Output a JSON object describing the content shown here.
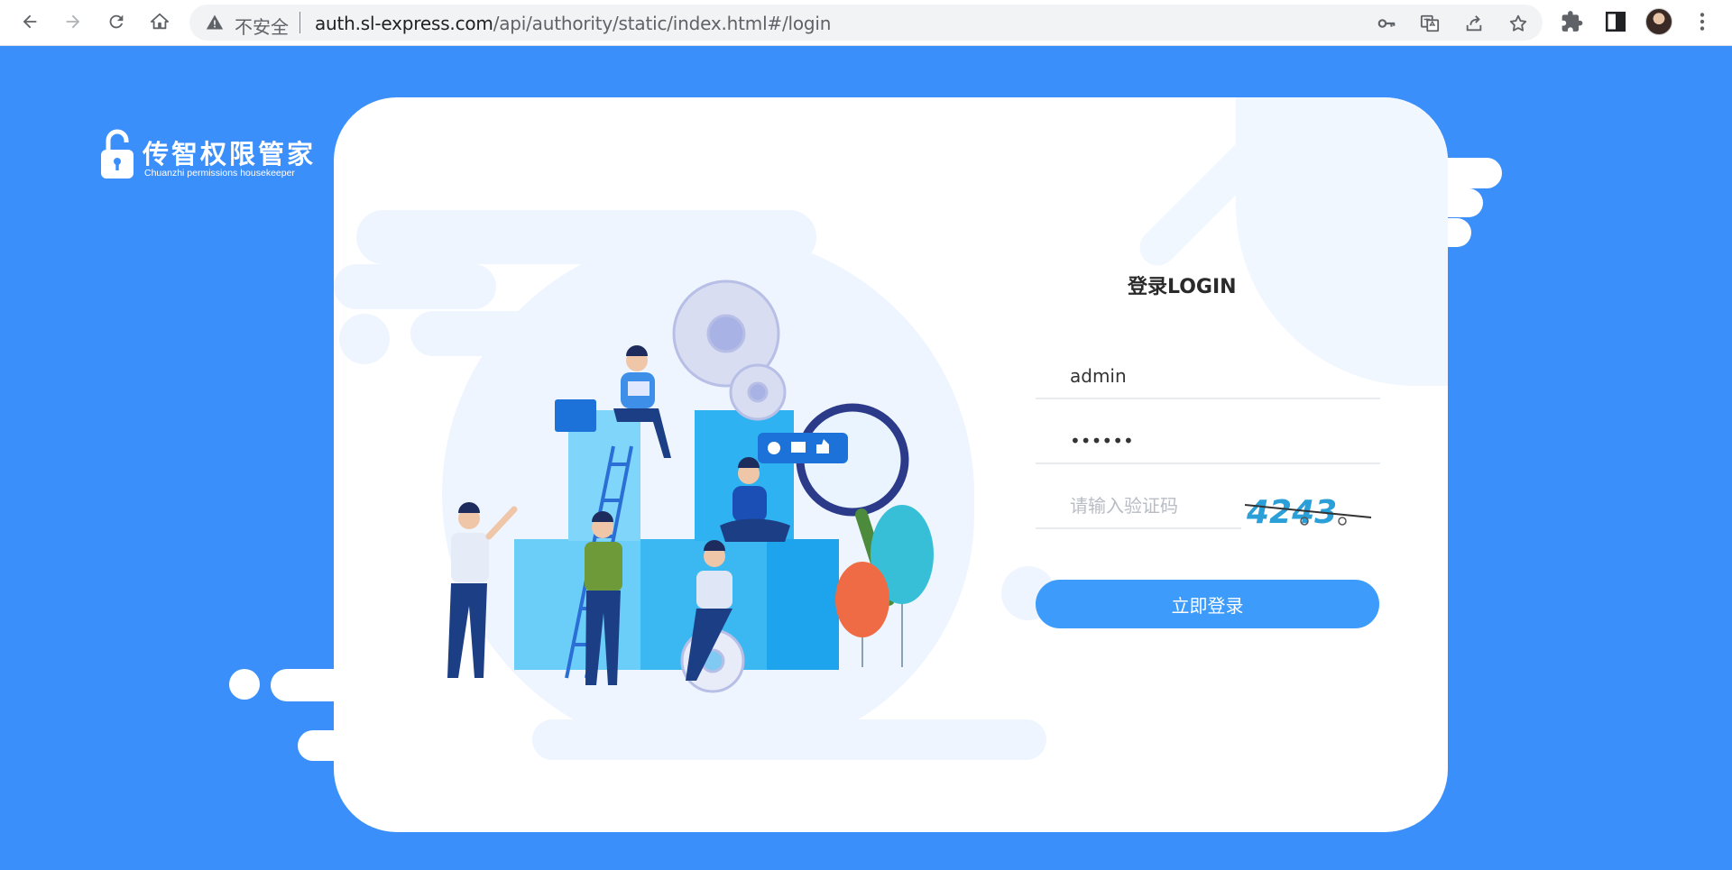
{
  "browser": {
    "security_label": "不安全",
    "url_host": "auth.sl-express.com",
    "url_path": "/api/authority/static/index.html#/login",
    "icons": [
      "back-icon",
      "forward-icon",
      "reload-icon",
      "home-icon",
      "warning-icon",
      "key-icon",
      "translate-icon",
      "share-icon",
      "star-icon",
      "extensions-icon",
      "side-panel-icon",
      "avatar",
      "menu-icon"
    ]
  },
  "logo": {
    "title": "传智权限管家",
    "subtitle": "Chuanzhi permissions housekeeper"
  },
  "login": {
    "title": "登录LOGIN",
    "username_value": "admin",
    "password_value": "••••••",
    "captcha_placeholder": "请输入验证码",
    "captcha_code": "4243",
    "submit_label": "立即登录"
  },
  "colors": {
    "page_bg": "#3b8ffb",
    "button": "#3c9bfb",
    "card": "#ffffff"
  }
}
